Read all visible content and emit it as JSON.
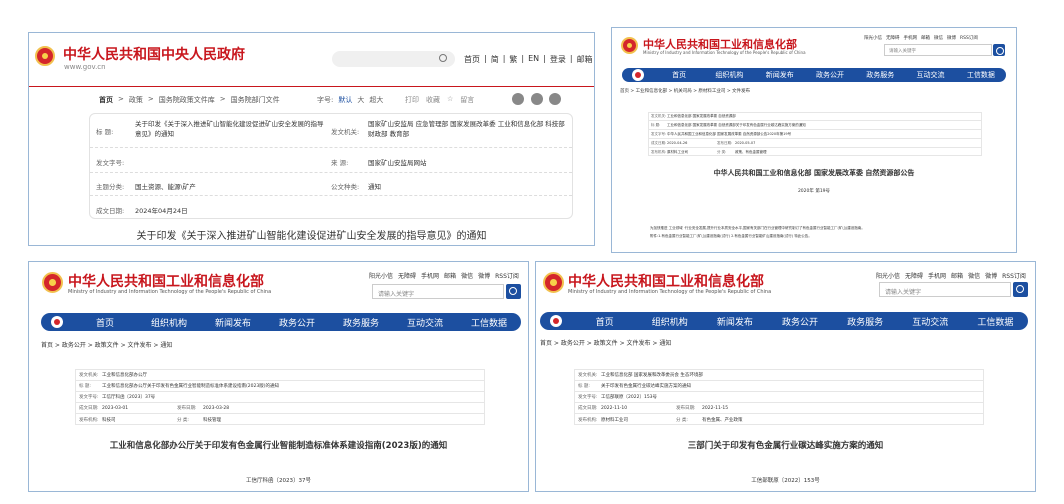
{
  "gov": {
    "site_name": "中华人民共和国中央人民政府",
    "domain": "www.gov.cn",
    "nav": [
      "首页",
      "简",
      "繁",
      "EN",
      "登录",
      "邮箱"
    ],
    "nav_sep": "|",
    "breadcrumb": [
      "首页",
      "政策",
      "国务院政策文件库",
      "国务院部门文件"
    ],
    "crumb_sep": ">",
    "font_label": "字号:",
    "font_options": [
      "默认",
      "大",
      "超大"
    ],
    "tools": [
      "打印",
      "收藏",
      "留言"
    ],
    "fields": {
      "title_label": "标  题:",
      "title_value": "关于印发《关于深入推进矿山智能化建设促进矿山安全发展的指导意见》的通知",
      "issuer_label": "发文机关:",
      "issuer_value": "国家矿山安监局 应急管理部 国家发展改革委 工业和信息化部 科技部 财政部 教育部",
      "docno_label": "发文字号:",
      "source_label": "来  源:",
      "source_value": "国家矿山安监局网站",
      "topic_label": "主题分类:",
      "topic_value": "国土资源、能源\\矿产",
      "type_label": "公文种类:",
      "type_value": "通知",
      "date_label": "成文日期:",
      "date_value": "2024年04月24日"
    },
    "caption": "关于印发《关于深入推进矿山智能化建设促进矿山安全发展的指导意见》的通知"
  },
  "miit_common": {
    "name_cn": "中华人民共和国工业和信息化部",
    "name_en": "Ministry of Industry and Information Technology of the People's Republic of China",
    "top_links": [
      "阳光小信",
      "无障碍",
      "手机网",
      "邮箱",
      "微信",
      "微博",
      "RSS订阅"
    ],
    "search_placeholder": "请输入关键字",
    "nav": [
      "首页",
      "组织机构",
      "新闻发布",
      "政务公开",
      "政务服务",
      "互动交流",
      "工信数据"
    ]
  },
  "miit1": {
    "breadcrumb": "首页 > 工业和信息化部 > 机关司局 > 原材料工业司 > 文件发布",
    "meta": [
      [
        "发文机关:",
        "工业和信息化部 国家发展改革委 自然资源部"
      ],
      [
        "标  题:",
        "工业和信息化部 国家发展改革委 自然资源部关于印发有色金属行业碳达峰实施方案的通知"
      ],
      [
        "发文字号:",
        "中华人民共和国工业和信息化部 国家发展改革委 自然资源部公告2020年第19号"
      ]
    ],
    "date_row": [
      "成文日期:",
      "2020-04-26",
      "发布日期:",
      "2020-05-07"
    ],
    "cat_row": [
      "发布机构:",
      "原材料工业司",
      "分  类:",
      "政策、有色金属管理"
    ],
    "title": "中华人民共和国工业和信息化部 国家发展改革委 自然资源部公告",
    "number": "2020年 第19号",
    "body1": "为加快推进 工业领域 ·行业安全发展,提升行业本质安全水平,国家有关部门在行业管理中研究制订了有色金属行业智能工厂(矿山)建设指南。",
    "body2": "附件:1.有色金属行业智能工厂(矿山)建设指南(试行) 2.有色金属行业智能矿山建设指南(试行) 特此公告。"
  },
  "miit2": {
    "breadcrumb": "首页 > 政务公开 > 政策文件 > 文件发布 > 通知",
    "meta": [
      [
        "发文机关:",
        "工业和信息化部办公厅"
      ],
      [
        "标  题:",
        "工业和信息化部办公厅关于印发有色金属行业智能制造标准体系建设指南(2023版)的通知"
      ],
      [
        "发文字号:",
        "工信厅科函〔2023〕37号"
      ]
    ],
    "date_row": [
      "成文日期:",
      "2023-03-01",
      "发布日期:",
      "2023-03-28"
    ],
    "cat_row": [
      "发布机构:",
      "科技司",
      "分  类:",
      "科技管理"
    ],
    "title": "工业和信息化部办公厅关于印发有色金属行业智能制造标准体系建设指南(2023版)的通知",
    "number": "工信厅科函〔2023〕37号"
  },
  "miit3": {
    "breadcrumb": "首页 > 政务公开 > 政策文件 > 文件发布 > 通知",
    "meta": [
      [
        "发文机关:",
        "工业和信息化部 国家发展和改革委员会 生态环境部"
      ],
      [
        "标  题:",
        "关于印发有色金属行业碳达峰实施方案的通知"
      ],
      [
        "发文字号:",
        "工信部联原〔2022〕153号"
      ]
    ],
    "date_row": [
      "成文日期:",
      "2022-11-10",
      "发布日期:",
      "2022-11-15"
    ],
    "cat_row": [
      "发布机构:",
      "原材料工业司",
      "分  类:",
      "有色金属、产业政策"
    ],
    "title": "三部门关于印发有色金属行业碳达峰实施方案的通知",
    "number": "工信部联原〔2022〕153号"
  },
  "colors": {
    "gov_red": "#c8161d",
    "miit_blue": "#1c4fa0",
    "border": "#9ab7d6"
  }
}
